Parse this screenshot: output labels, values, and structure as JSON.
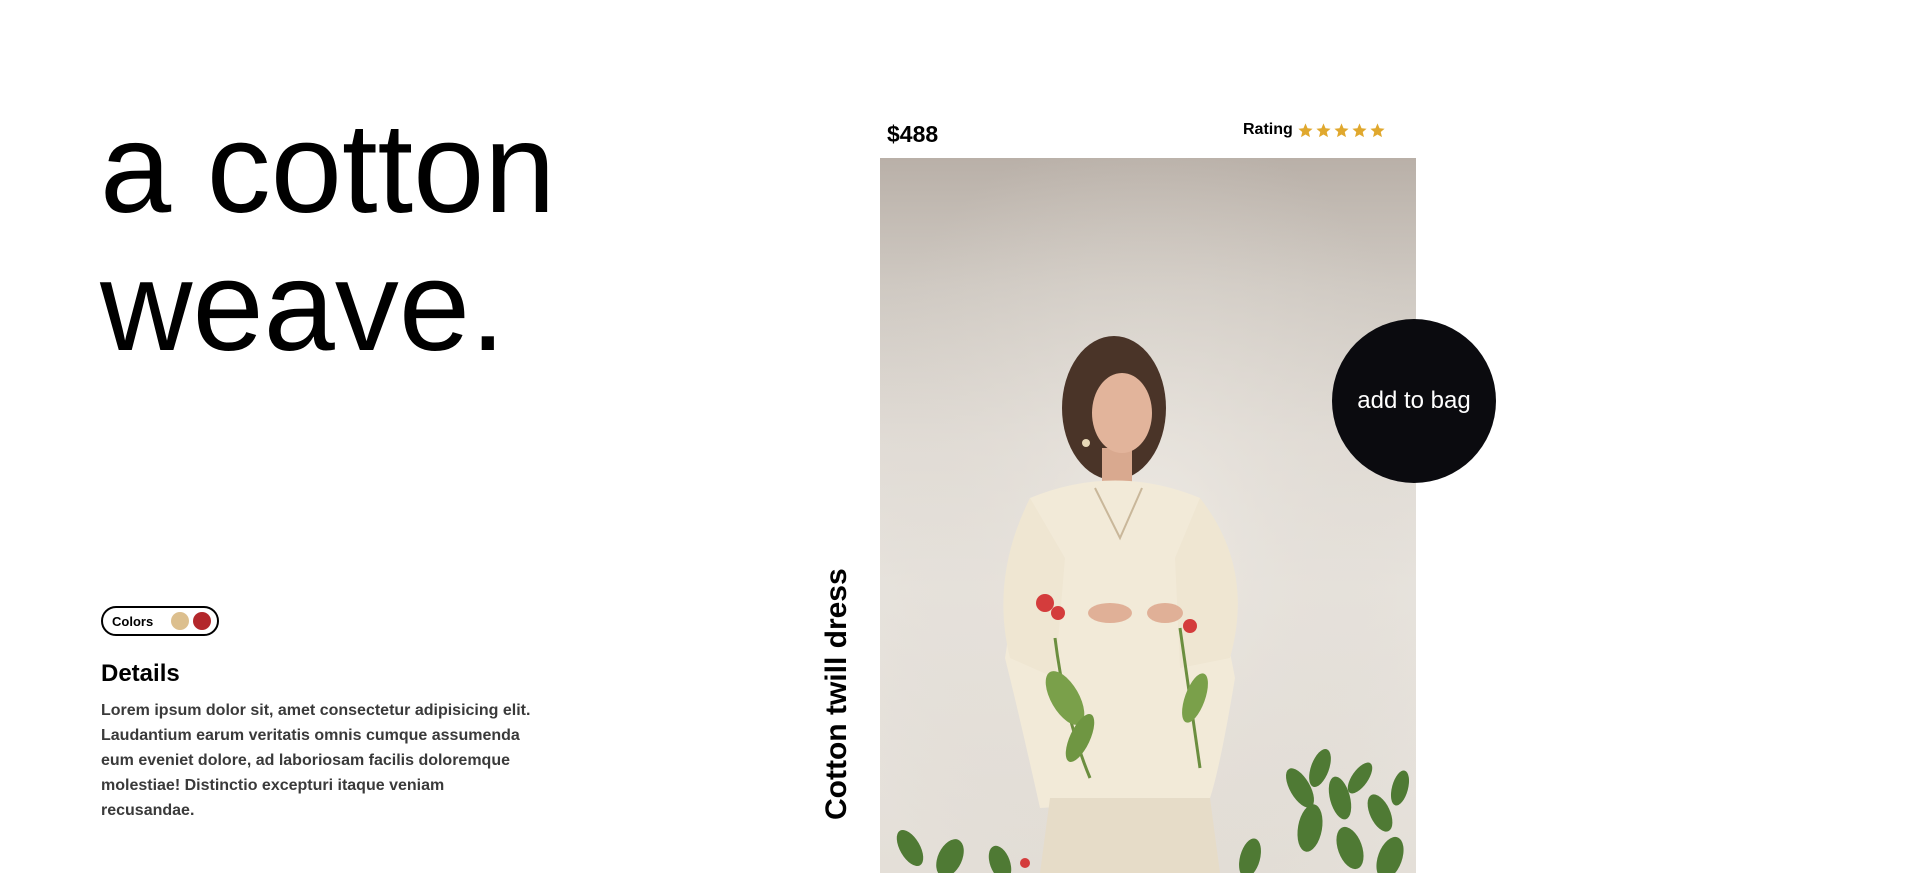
{
  "hero": {
    "line1": "a cotton",
    "line2": "weave."
  },
  "colors": {
    "label": "Colors",
    "swatches": [
      {
        "name": "beige",
        "hex": "#dcbf8e"
      },
      {
        "name": "red",
        "hex": "#b3272b"
      }
    ]
  },
  "details": {
    "heading": "Details",
    "body": "Lorem ipsum dolor sit, amet consectetur adipisicing elit. Laudantium earum veritatis omnis cumque assumenda eum eveniet dolore, ad laboriosam facilis doloremque molestiae! Distinctio excepturi itaque veniam recusandae."
  },
  "product": {
    "name": "Cotton twill dress",
    "price": "$488",
    "rating_label": "Rating",
    "rating_value": 5,
    "rating_max": 5,
    "star_color": "#e0a82e"
  },
  "cta": {
    "label": "add to bag"
  }
}
